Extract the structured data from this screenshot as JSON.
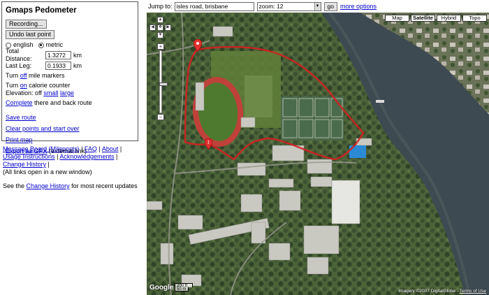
{
  "panel": {
    "title": "Gmaps Pedometer",
    "recording_button": "Recording...",
    "undo_button": "Undo last point",
    "unit_english": "english",
    "unit_metric": "metric",
    "total_distance_label": "Total Distance:",
    "total_distance_value": "1.3272",
    "total_distance_unit": "km",
    "last_leg_label": "Last Leg:",
    "last_leg_value": "0.1933",
    "last_leg_unit": "km",
    "mile_markers_prefix": "Turn",
    "mile_markers_link": "off",
    "mile_markers_suffix": "mile markers",
    "calorie_prefix": "Turn",
    "calorie_link": "on",
    "calorie_suffix": "calorie counter",
    "elevation_label": "Elevation:",
    "elevation_off": "off",
    "elevation_small": "small",
    "elevation_large": "large",
    "complete_link": "Complete",
    "complete_suffix": "there and back route",
    "save_route": "Save route",
    "clear_points": "Clear points and start over",
    "print_map": "Print map",
    "export_gpx": "Export as GPX",
    "export_suffix": "(external link)"
  },
  "footer": {
    "message_board": "Message Board (Mileposts)",
    "sep1": "|",
    "faq": "FAQ",
    "sep2": "|",
    "about": "About",
    "sep3": "|",
    "usage_instructions": "Usage Instructions",
    "sep4": "|",
    "acknowledgements": "Acknowledgements",
    "sep5": "|",
    "change_history": "Change History",
    "sep6": "|",
    "new_window_note": "(All links open in a new window)",
    "see_prefix": "See the",
    "see_link": "Change History",
    "see_suffix": "for most recent updates"
  },
  "toolbar": {
    "jump_label": "Jump to:",
    "jump_value": "isles road, brisbane",
    "zoom_value": "zoom: 12",
    "go_button": "go",
    "more_options": "more options"
  },
  "map": {
    "type_buttons": [
      "Map",
      "Satellite",
      "Hybrid",
      "Topo"
    ],
    "active_type": "Satellite",
    "logo": "Google",
    "scale_top": "200 ft",
    "scale_bottom": "50 m",
    "attribution": "Imagery ©2007 DigitalGlobe -",
    "terms": "Terms of Use",
    "marker_start_label": "1",
    "route_color": "#d42020",
    "river_color": "#3d4a52",
    "track_color": "#c0413a",
    "field_color": "#5f7d3a"
  }
}
